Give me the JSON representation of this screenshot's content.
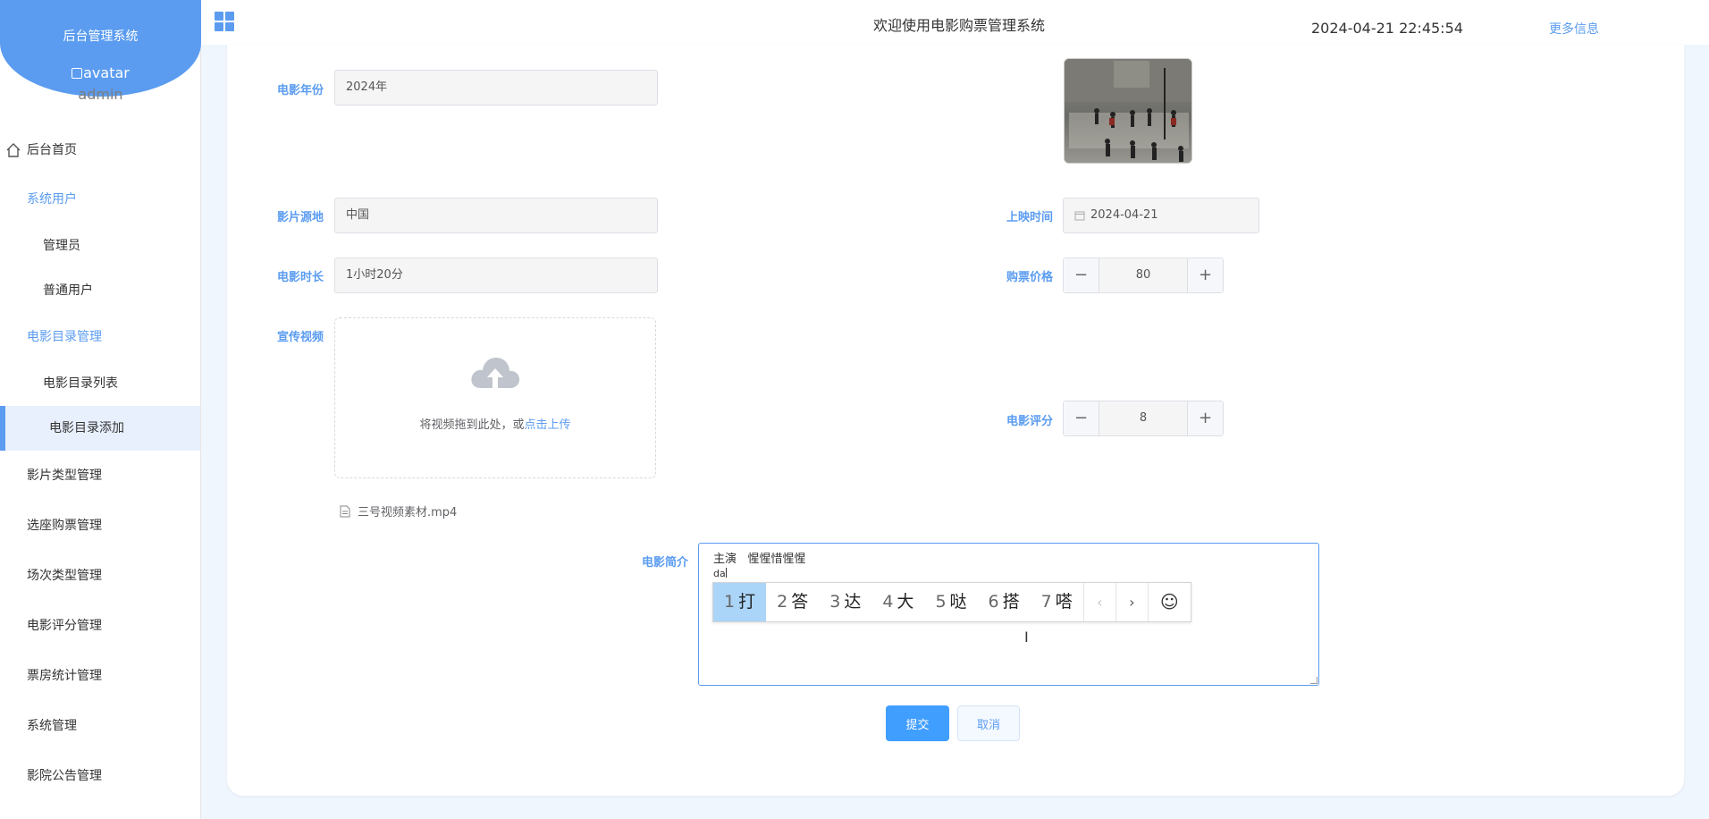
{
  "sidebar": {
    "brand_title": "后台管理系统",
    "avatar_alt": "avatar",
    "username": "admin",
    "items": [
      {
        "label": "后台首页"
      },
      {
        "label": "系统用户"
      },
      {
        "label": "管理员"
      },
      {
        "label": "普通用户"
      },
      {
        "label": "电影目录管理"
      },
      {
        "label": "电影目录列表"
      },
      {
        "label": "电影目录添加"
      },
      {
        "label": "影片类型管理"
      },
      {
        "label": "选座购票管理"
      },
      {
        "label": "场次类型管理"
      },
      {
        "label": "电影评分管理"
      },
      {
        "label": "票房统计管理"
      },
      {
        "label": "系统管理"
      },
      {
        "label": "影院公告管理"
      }
    ]
  },
  "header": {
    "title": "欢迎使用电影购票管理系统",
    "datetime": "2024-04-21 22:45:54",
    "more": "更多信息"
  },
  "form": {
    "year": {
      "label": "电影年份",
      "value": "2024年"
    },
    "origin": {
      "label": "影片源地",
      "value": "中国"
    },
    "release": {
      "label": "上映时间",
      "value": "2024-04-21"
    },
    "duration": {
      "label": "电影时长",
      "value": "1小时20分"
    },
    "price": {
      "label": "购票价格",
      "value": "80"
    },
    "video": {
      "label": "宣传视频",
      "hint": "将视频拖到此处，或",
      "hint_link": "点击上传",
      "file_name": "三号视频素材.mp4"
    },
    "rating": {
      "label": "电影评分",
      "value": "8"
    },
    "intro": {
      "label": "电影简介",
      "line1": "主演   惺惺惜惺惺",
      "line2": "da"
    },
    "submit": "提交",
    "cancel": "取消"
  },
  "ime": {
    "candidates": [
      {
        "num": "1",
        "char": "打"
      },
      {
        "num": "2",
        "char": "答"
      },
      {
        "num": "3",
        "char": "达"
      },
      {
        "num": "4",
        "char": "大"
      },
      {
        "num": "5",
        "char": "哒"
      },
      {
        "num": "6",
        "char": "搭"
      },
      {
        "num": "7",
        "char": "嗒"
      }
    ],
    "prev": "‹",
    "next": "›",
    "emoji": "☺"
  },
  "colors": {
    "accent": "#5b9cf0",
    "primary_button": "#409eff"
  }
}
